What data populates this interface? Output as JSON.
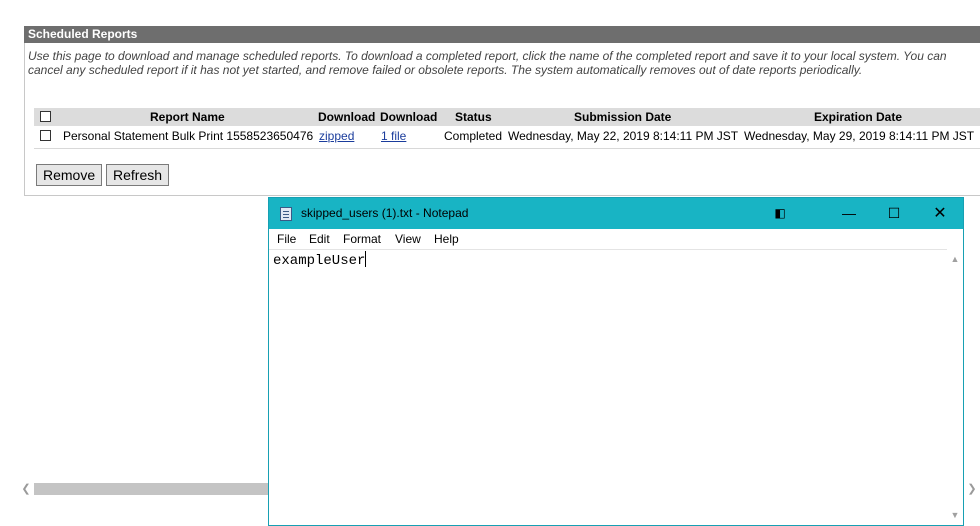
{
  "panel": {
    "title": "Scheduled Reports",
    "description": "Use this page to download and manage scheduled reports. To download a completed report, click the name of the completed report and save it to your local system. You can cancel any scheduled report if it has not yet started, and remove failed or obsolete reports. The system automatically removes out of date reports periodically."
  },
  "table": {
    "headers": {
      "report_name": "Report Name",
      "download1": "Download",
      "download2": "Download",
      "status": "Status",
      "submission": "Submission Date",
      "expiration": "Expiration Date"
    },
    "rows": [
      {
        "report_name": "Personal Statement Bulk Print 1558523650476",
        "download1": "zipped",
        "download2": "1 file",
        "status": "Completed",
        "submission": "Wednesday, May 22, 2019 8:14:11 PM JST",
        "expiration": "Wednesday, May 29, 2019 8:14:11 PM JST"
      }
    ]
  },
  "buttons": {
    "remove": "Remove",
    "refresh": "Refresh"
  },
  "notepad": {
    "title": "skipped_users (1).txt - Notepad",
    "menu": [
      "File",
      "Edit",
      "Format",
      "View",
      "Help"
    ],
    "content": "exampleUser",
    "accent_color": "#18b4c4"
  }
}
